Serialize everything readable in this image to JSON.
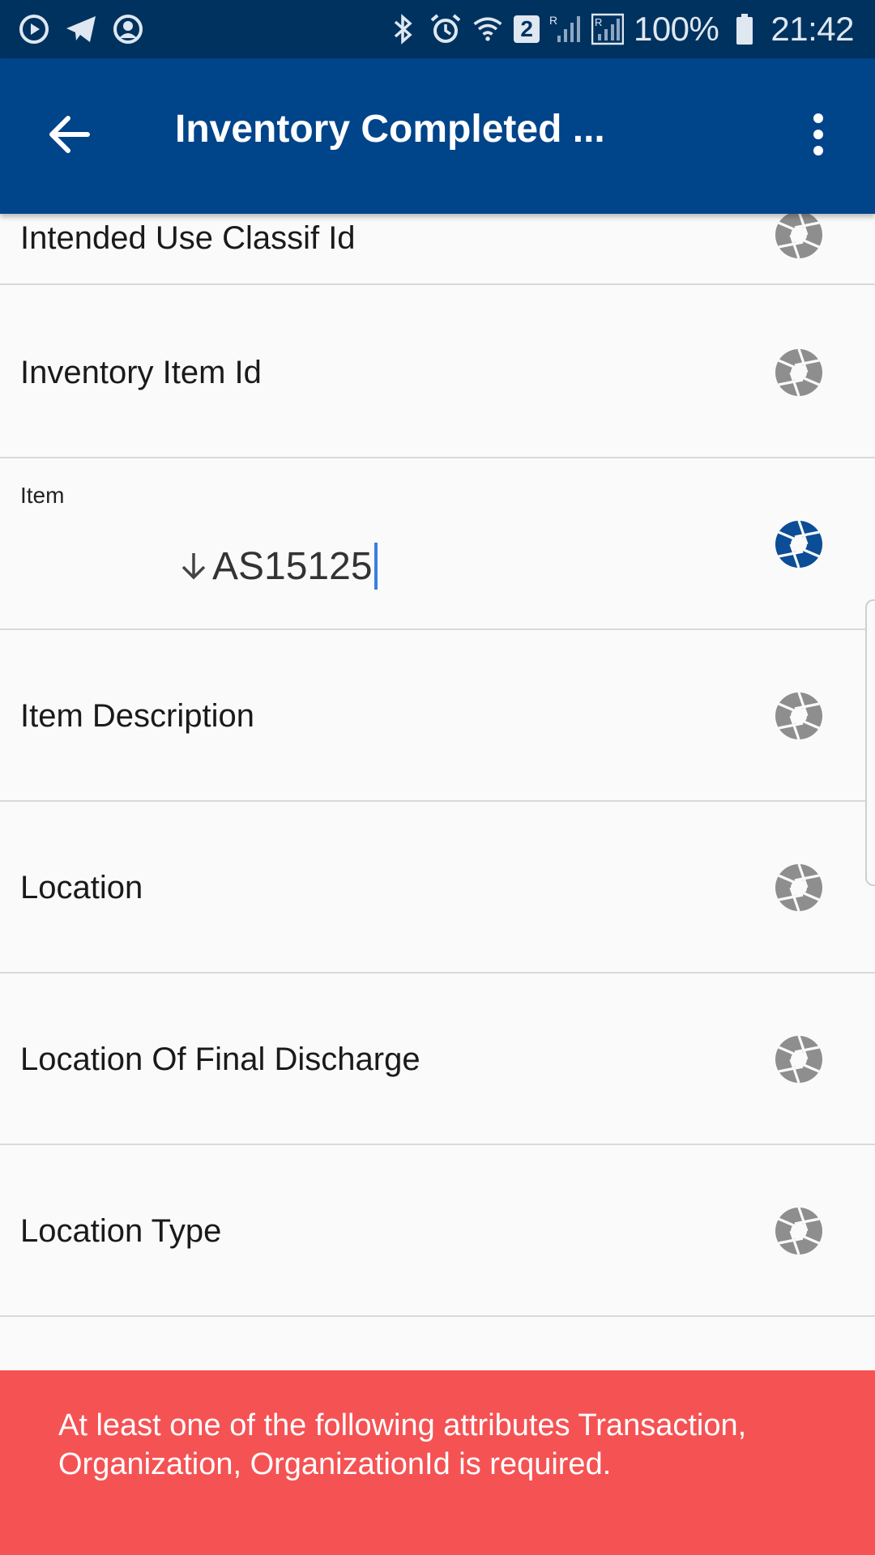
{
  "status_bar": {
    "left_icons": [
      "play-circle-icon",
      "telegram-icon",
      "account-circle-icon"
    ],
    "right_icons": [
      "bluetooth-icon",
      "alarm-icon",
      "wifi-icon",
      "sim-badge-icon",
      "signal-r-icon",
      "signal-r2-icon",
      "battery-icon"
    ],
    "sim_badge": "2",
    "battery": "100%",
    "time": "21:42"
  },
  "app_bar": {
    "title": "Inventory Completed ...",
    "back_icon": "arrow-left-icon",
    "menu_icon": "more-vert-icon"
  },
  "rows": [
    {
      "label": "Intended Use Classif Id",
      "icon": "shutter-icon",
      "active": false
    },
    {
      "label": "Inventory Item Id",
      "icon": "shutter-icon",
      "active": false
    },
    {
      "small_label": "Item",
      "value": "AS15125",
      "icon": "shutter-icon",
      "active": true
    },
    {
      "label": "Item Description",
      "icon": "shutter-icon",
      "active": false
    },
    {
      "label": "Location",
      "icon": "shutter-icon",
      "active": false
    },
    {
      "label": "Location Of Final Discharge",
      "icon": "shutter-icon",
      "active": false
    },
    {
      "label": "Location Type",
      "icon": "shutter-icon",
      "active": false
    }
  ],
  "colors": {
    "status_bar": "#00325f",
    "app_bar": "#00448a",
    "active_icon": "#0b4d96",
    "inactive_icon": "#8e8e8e",
    "error_banner": "#f55254"
  },
  "error": {
    "message": "At least one of the following attributes Transaction, Organization, OrganizationId is required."
  }
}
